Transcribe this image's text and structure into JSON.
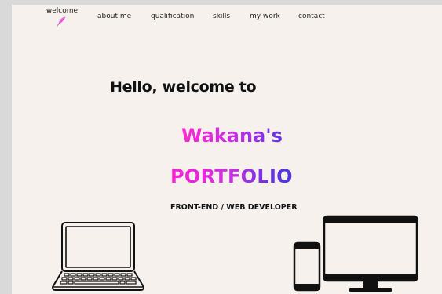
{
  "nav": {
    "welcome_label": "welcome",
    "items": [
      {
        "label": "about me"
      },
      {
        "label": "qualification"
      },
      {
        "label": "skills"
      },
      {
        "label": "my work"
      },
      {
        "label": "contact"
      }
    ]
  },
  "hero": {
    "greeting": "Hello, welcome to",
    "name": "Wakana's",
    "portfolio": "PORTFOLIO",
    "role": "FRONT-END / WEB DEVELOPER"
  },
  "icons": {
    "nav_icon": "feather-icon",
    "left_illustration": "laptop-icon",
    "right_illustration": "phone-and-monitor-icon"
  },
  "colors": {
    "page_background": "#f6f1ec",
    "outer_background": "#d9d9d9",
    "accent_pink": "#ff2ad0",
    "accent_purple": "#5a34e0",
    "text": "#111111"
  }
}
